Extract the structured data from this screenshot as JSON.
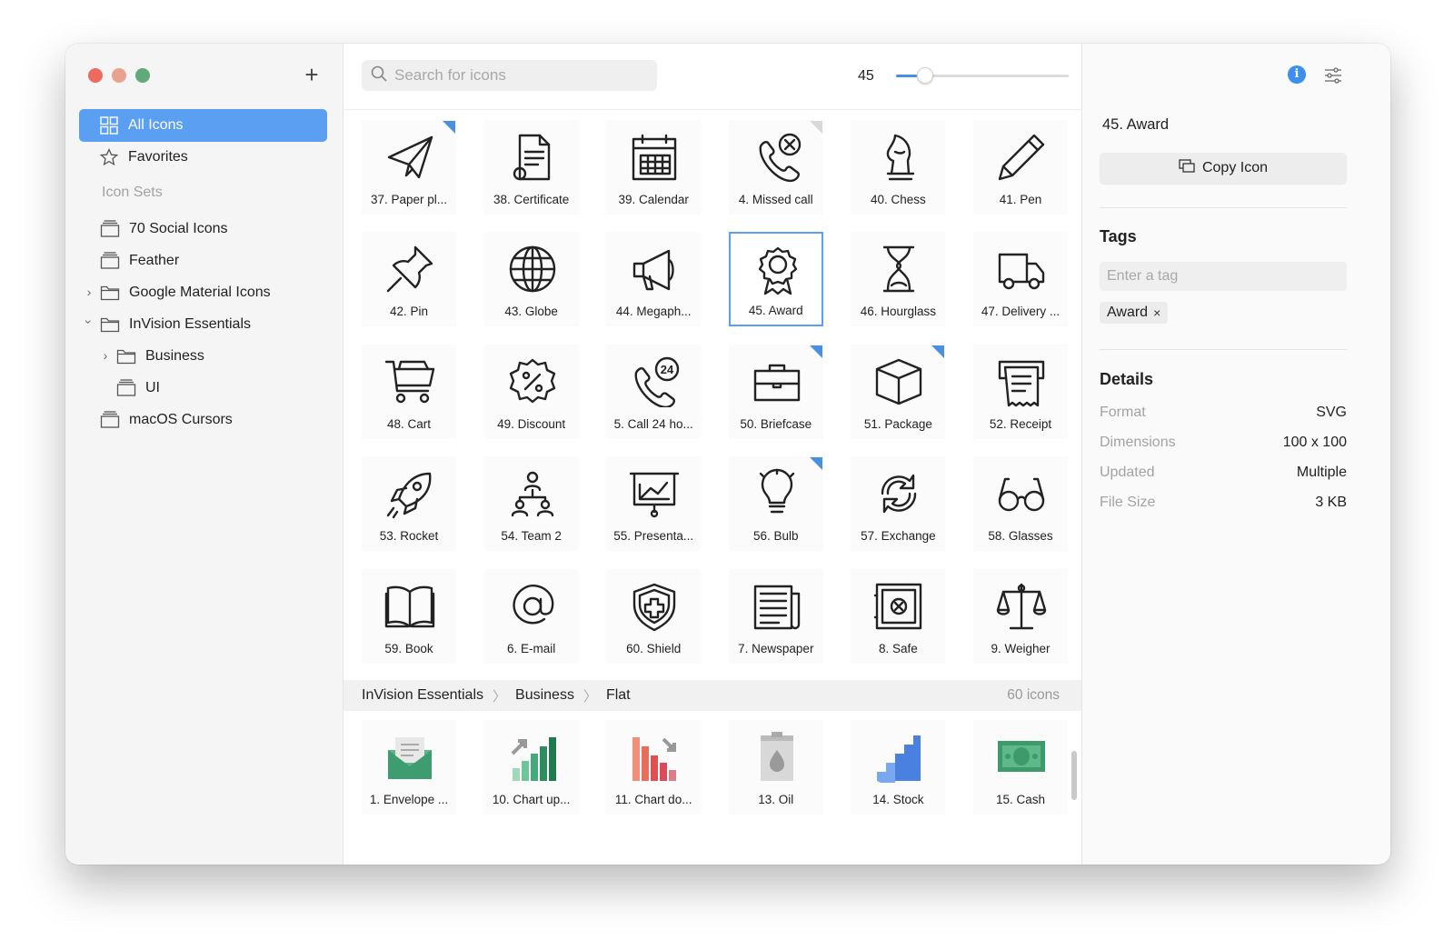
{
  "sidebar": {
    "add_label": "+",
    "all_icons": "All Icons",
    "favorites": "Favorites",
    "section_label": "Icon Sets",
    "sets": [
      {
        "label": "70 Social Icons"
      },
      {
        "label": "Feather"
      },
      {
        "label": "Google Material Icons"
      },
      {
        "label": "InVision Essentials"
      },
      {
        "label": "Business"
      },
      {
        "label": "UI"
      },
      {
        "label": "macOS Cursors"
      }
    ]
  },
  "toolbar": {
    "search_placeholder": "Search for icons",
    "size_value": "45",
    "size_fraction": 0.12
  },
  "icons": [
    {
      "label": "37. Paper pl...",
      "icon": "paper-plane-icon",
      "corner": "blue"
    },
    {
      "label": "38. Certificate",
      "icon": "certificate-icon",
      "corner": ""
    },
    {
      "label": "39. Calendar",
      "icon": "calendar-icon",
      "corner": ""
    },
    {
      "label": "4. Missed call",
      "icon": "missed-call-icon",
      "corner": "grey"
    },
    {
      "label": "40. Chess",
      "icon": "chess-icon",
      "corner": ""
    },
    {
      "label": "41. Pen",
      "icon": "pen-icon",
      "corner": ""
    },
    {
      "label": "42. Pin",
      "icon": "pin-icon",
      "corner": ""
    },
    {
      "label": "43. Globe",
      "icon": "globe-icon",
      "corner": ""
    },
    {
      "label": "44. Megaph...",
      "icon": "megaphone-icon",
      "corner": ""
    },
    {
      "label": "45. Award",
      "icon": "award-icon",
      "corner": "",
      "selected": true
    },
    {
      "label": "46. Hourglass",
      "icon": "hourglass-icon",
      "corner": ""
    },
    {
      "label": "47. Delivery ...",
      "icon": "delivery-truck-icon",
      "corner": ""
    },
    {
      "label": "48. Cart",
      "icon": "cart-icon",
      "corner": ""
    },
    {
      "label": "49. Discount",
      "icon": "discount-icon",
      "corner": ""
    },
    {
      "label": "5. Call 24 ho...",
      "icon": "call-24-icon",
      "corner": ""
    },
    {
      "label": "50. Briefcase",
      "icon": "briefcase-icon",
      "corner": "blue"
    },
    {
      "label": "51. Package",
      "icon": "package-icon",
      "corner": "blue"
    },
    {
      "label": "52. Receipt",
      "icon": "receipt-icon",
      "corner": ""
    },
    {
      "label": "53. Rocket",
      "icon": "rocket-icon",
      "corner": ""
    },
    {
      "label": "54. Team 2",
      "icon": "team-icon",
      "corner": ""
    },
    {
      "label": "55. Presenta...",
      "icon": "presentation-icon",
      "corner": ""
    },
    {
      "label": "56. Bulb",
      "icon": "bulb-icon",
      "corner": "blue"
    },
    {
      "label": "57. Exchange",
      "icon": "exchange-icon",
      "corner": ""
    },
    {
      "label": "58. Glasses",
      "icon": "glasses-icon",
      "corner": ""
    },
    {
      "label": "59. Book",
      "icon": "book-icon",
      "corner": ""
    },
    {
      "label": "6. E-mail",
      "icon": "email-at-icon",
      "corner": ""
    },
    {
      "label": "60. Shield",
      "icon": "shield-icon",
      "corner": ""
    },
    {
      "label": "7. Newspaper",
      "icon": "newspaper-icon",
      "corner": ""
    },
    {
      "label": "8. Safe",
      "icon": "safe-icon",
      "corner": ""
    },
    {
      "label": "9. Weigher",
      "icon": "weigher-icon",
      "corner": ""
    }
  ],
  "breadcrumb": {
    "parts": [
      "InVision Essentials",
      "Business",
      "Flat"
    ],
    "count": "60 icons"
  },
  "flat_icons": [
    {
      "label": "1. Envelope ...",
      "icon": "envelope-flat-icon"
    },
    {
      "label": "10. Chart up...",
      "icon": "chart-up-flat-icon"
    },
    {
      "label": "11. Chart do...",
      "icon": "chart-down-flat-icon"
    },
    {
      "label": "13. Oil",
      "icon": "oil-flat-icon"
    },
    {
      "label": "14. Stock",
      "icon": "stock-flat-icon"
    },
    {
      "label": "15. Cash",
      "icon": "cash-flat-icon"
    }
  ],
  "inspector": {
    "title": "45. Award",
    "copy_label": "Copy Icon",
    "tags_heading": "Tags",
    "tag_placeholder": "Enter a tag",
    "tags": [
      "Award"
    ],
    "details_heading": "Details",
    "details": [
      {
        "key": "Format",
        "value": "SVG"
      },
      {
        "key": "Dimensions",
        "value": "100 x 100"
      },
      {
        "key": "Updated",
        "value": "Multiple"
      },
      {
        "key": "File Size",
        "value": "3 KB"
      }
    ]
  },
  "colors": {
    "accent": "#5a9ff2",
    "corner_badge": "#4a90e2",
    "info": "#3b8ff0"
  }
}
